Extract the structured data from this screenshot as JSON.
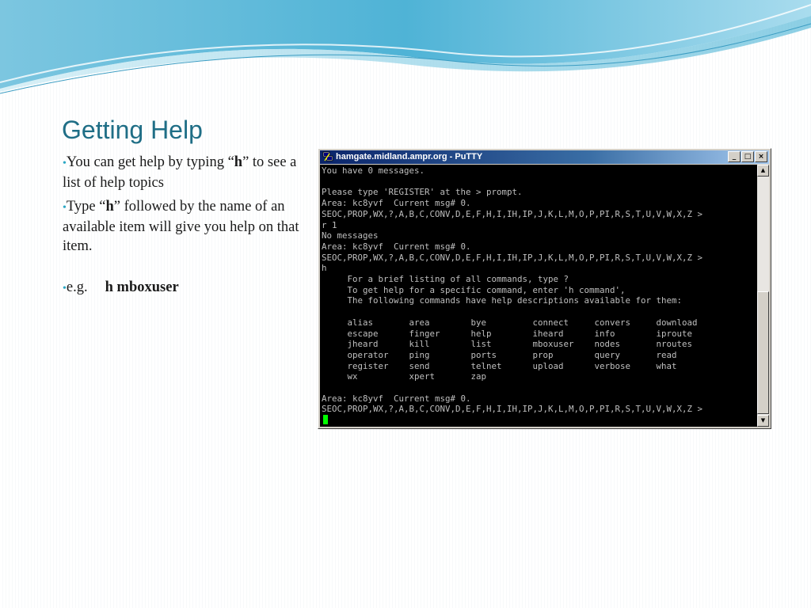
{
  "slide": {
    "title": "Getting Help",
    "bullets": {
      "b1_pre": "You can get help by typing “",
      "b1_key": "h",
      "b1_post": "” to see a list of help topics",
      "b2_pre": "Type “",
      "b2_key": "h",
      "b2_post": "” followed by the name of an available item will give you help on that item.",
      "example_label": "e.g.",
      "example_cmd": "h mboxuser"
    }
  },
  "colors": {
    "title": "#1f6e86",
    "bullet_dot": "#2aa7c4",
    "titlebar_start": "#0a246a",
    "titlebar_end": "#a6caf0",
    "terminal_bg": "#000000",
    "terminal_fg": "#bfbfbf",
    "cursor": "#00ff00"
  },
  "window": {
    "title": "hamgate.midland.ampr.org - PuTTY",
    "icon": "putty-app-icon",
    "buttons": {
      "minimize": "_",
      "maximize": "□",
      "close": "×"
    },
    "scrollbar": {
      "up": "▲",
      "down": "▼"
    }
  },
  "terminal": {
    "output": "You have 0 messages.\n\nPlease type 'REGISTER' at the > prompt.\nArea: kc8yvf  Current msg# 0.\nSEOC,PROP,WX,?,A,B,C,CONV,D,E,F,H,I,IH,IP,J,K,L,M,O,P,PI,R,S,T,U,V,W,X,Z >\nr 1\nNo messages\nArea: kc8yvf  Current msg# 0.\nSEOC,PROP,WX,?,A,B,C,CONV,D,E,F,H,I,IH,IP,J,K,L,M,O,P,PI,R,S,T,U,V,W,X,Z >\nh\n     For a brief listing of all commands, type ?\n     To get help for a specific command, enter 'h command',\n     The following commands have help descriptions available for them:\n\n     alias       area        bye         connect     convers     download\n     escape      finger      help        iheard      info        iproute\n     jheard      kill        list        mboxuser    nodes       nroutes\n     operator    ping        ports       prop        query       read\n     register    send        telnet      upload      verbose     what\n     wx          xpert       zap\n\nArea: kc8yvf  Current msg# 0.\nSEOC,PROP,WX,?,A,B,C,CONV,D,E,F,H,I,IH,IP,J,K,L,M,O,P,PI,R,S,T,U,V,W,X,Z >\n"
  }
}
